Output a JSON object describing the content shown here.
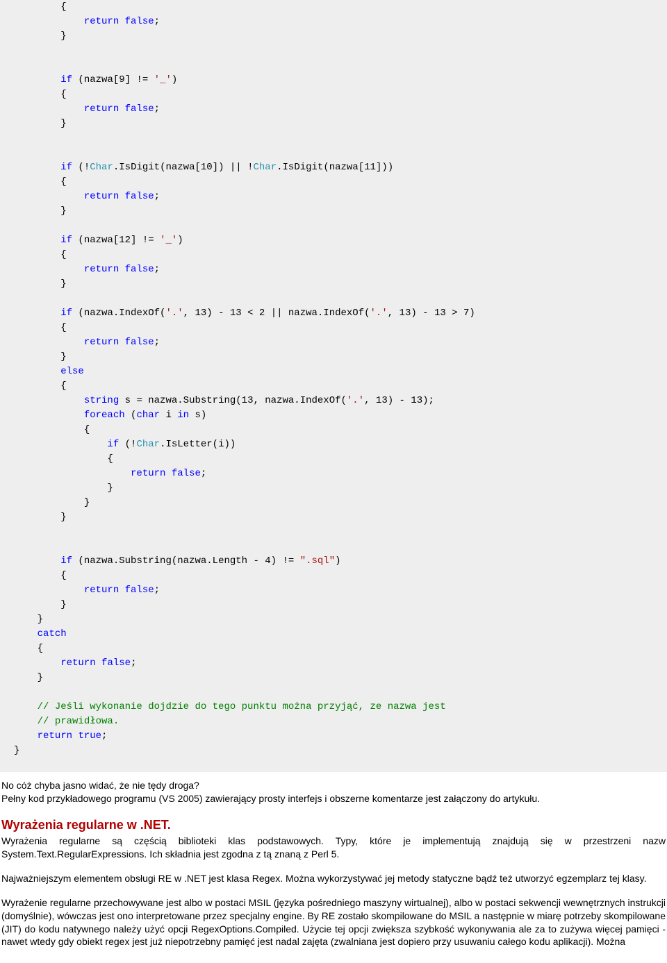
{
  "code": {
    "l1": "        {",
    "l2_a": "            ",
    "l2_kw": "return",
    "l2_b": " ",
    "l2_val": "false",
    "l2_c": ";",
    "l3": "        }",
    "l4": "",
    "l5": "",
    "l6_a": "        ",
    "l6_kw": "if",
    "l6_b": " (nazwa[9] != ",
    "l6_str": "'_'",
    "l6_c": ")",
    "l7": "        {",
    "l8_a": "            ",
    "l8_kw": "return",
    "l8_b": " ",
    "l8_val": "false",
    "l8_c": ";",
    "l9": "        }",
    "l10": "",
    "l11": "",
    "l12_a": "        ",
    "l12_kw": "if",
    "l12_b": " (!",
    "l12_cls1": "Char",
    "l12_c": ".IsDigit(nazwa[10]) || !",
    "l12_cls2": "Char",
    "l12_d": ".IsDigit(nazwa[11]))",
    "l13": "        {",
    "l14_a": "            ",
    "l14_kw": "return",
    "l14_b": " ",
    "l14_val": "false",
    "l14_c": ";",
    "l15": "        }",
    "l16": "",
    "l17_a": "        ",
    "l17_kw": "if",
    "l17_b": " (nazwa[12] != ",
    "l17_str": "'_'",
    "l17_c": ")",
    "l18": "        {",
    "l19_a": "            ",
    "l19_kw": "return",
    "l19_b": " ",
    "l19_val": "false",
    "l19_c": ";",
    "l20": "        }",
    "l21": "",
    "l22_a": "        ",
    "l22_kw": "if",
    "l22_b": " (nazwa.IndexOf(",
    "l22_str1": "'.'",
    "l22_c": ", 13) - 13 < 2 || nazwa.IndexOf(",
    "l22_str2": "'.'",
    "l22_d": ", 13) - 13 > 7)",
    "l23": "        {",
    "l24_a": "            ",
    "l24_kw": "return",
    "l24_b": " ",
    "l24_val": "false",
    "l24_c": ";",
    "l25": "        }",
    "l26_a": "        ",
    "l26_kw": "else",
    "l27": "        {",
    "l28_a": "            ",
    "l28_kw": "string",
    "l28_b": " s = nazwa.Substring(13, nazwa.IndexOf(",
    "l28_str": "'.'",
    "l28_c": ", 13) - 13);",
    "l29_a": "            ",
    "l29_kw": "foreach",
    "l29_b": " (",
    "l29_kw2": "char",
    "l29_c": " i ",
    "l29_kw3": "in",
    "l29_d": " s)",
    "l30": "            {",
    "l31_a": "                ",
    "l31_kw": "if",
    "l31_b": " (!",
    "l31_cls": "Char",
    "l31_c": ".IsLetter(i))",
    "l32": "                {",
    "l33_a": "                    ",
    "l33_kw": "return",
    "l33_b": " ",
    "l33_val": "false",
    "l33_c": ";",
    "l34": "                }",
    "l35": "            }",
    "l36": "        }",
    "l37": "",
    "l38": "",
    "l39_a": "        ",
    "l39_kw": "if",
    "l39_b": " (nazwa.Substring(nazwa.Length - 4) != ",
    "l39_str": "\".sql\"",
    "l39_c": ")",
    "l40": "        {",
    "l41_a": "            ",
    "l41_kw": "return",
    "l41_b": " ",
    "l41_val": "false",
    "l41_c": ";",
    "l42": "        }",
    "l43": "    }",
    "l44_a": "    ",
    "l44_kw": "catch",
    "l45": "    {",
    "l46_a": "        ",
    "l46_kw": "return",
    "l46_b": " ",
    "l46_val": "false",
    "l46_c": ";",
    "l47": "    }",
    "l48": "",
    "l49_a": "    ",
    "l49_cmt": "// Jeśli wykonanie dojdzie do tego punktu można przyjąć, ze nazwa jest",
    "l50_a": "    ",
    "l50_cmt": "// prawidłowa.",
    "l51_a": "    ",
    "l51_kw": "return",
    "l51_b": " ",
    "l51_val": "true",
    "l51_c": ";",
    "l52": "}"
  },
  "article": {
    "p1": "No cóż chyba jasno widać, że nie tędy droga?",
    "p2": "Pełny kod przykładowego programu (VS 2005) zawierający prosty interfejs i obszerne komentarze jest załączony do artykułu.",
    "h2": "Wyrażenia regularne w .NET.",
    "p3": "Wyrażenia regularne są częścią biblioteki klas podstawowych. Typy, które je implementują znajdują się w przestrzeni nazw System.Text.RegularExpressions. Ich składnia jest zgodna z tą znaną z Perl 5.",
    "p4": "Najważniejszym elementem obsługi RE w .NET jest klasa Regex. Można wykorzystywać jej metody statyczne bądź też utworzyć egzemplarz tej klasy.",
    "p5": "Wyrażenie regularne przechowywane jest albo w postaci MSIL (języka pośredniego maszyny wirtualnej), albo w postaci sekwencji wewnętrznych instrukcji (domyślnie), wówczas jest ono interpretowane przez specjalny engine. By RE zostało skompilowane do MSIL a następnie w miarę potrzeby skompilowane (JIT) do kodu natywnego należy użyć opcji RegexOptions.Compiled. Użycie tej opcji zwiększa szybkość wykonywania ale za to zużywa więcej pamięci - nawet wtedy gdy obiekt regex jest już niepotrzebny pamięć jest nadal zajęta (zwalniana jest dopiero przy usuwaniu całego kodu aplikacji). Można"
  }
}
